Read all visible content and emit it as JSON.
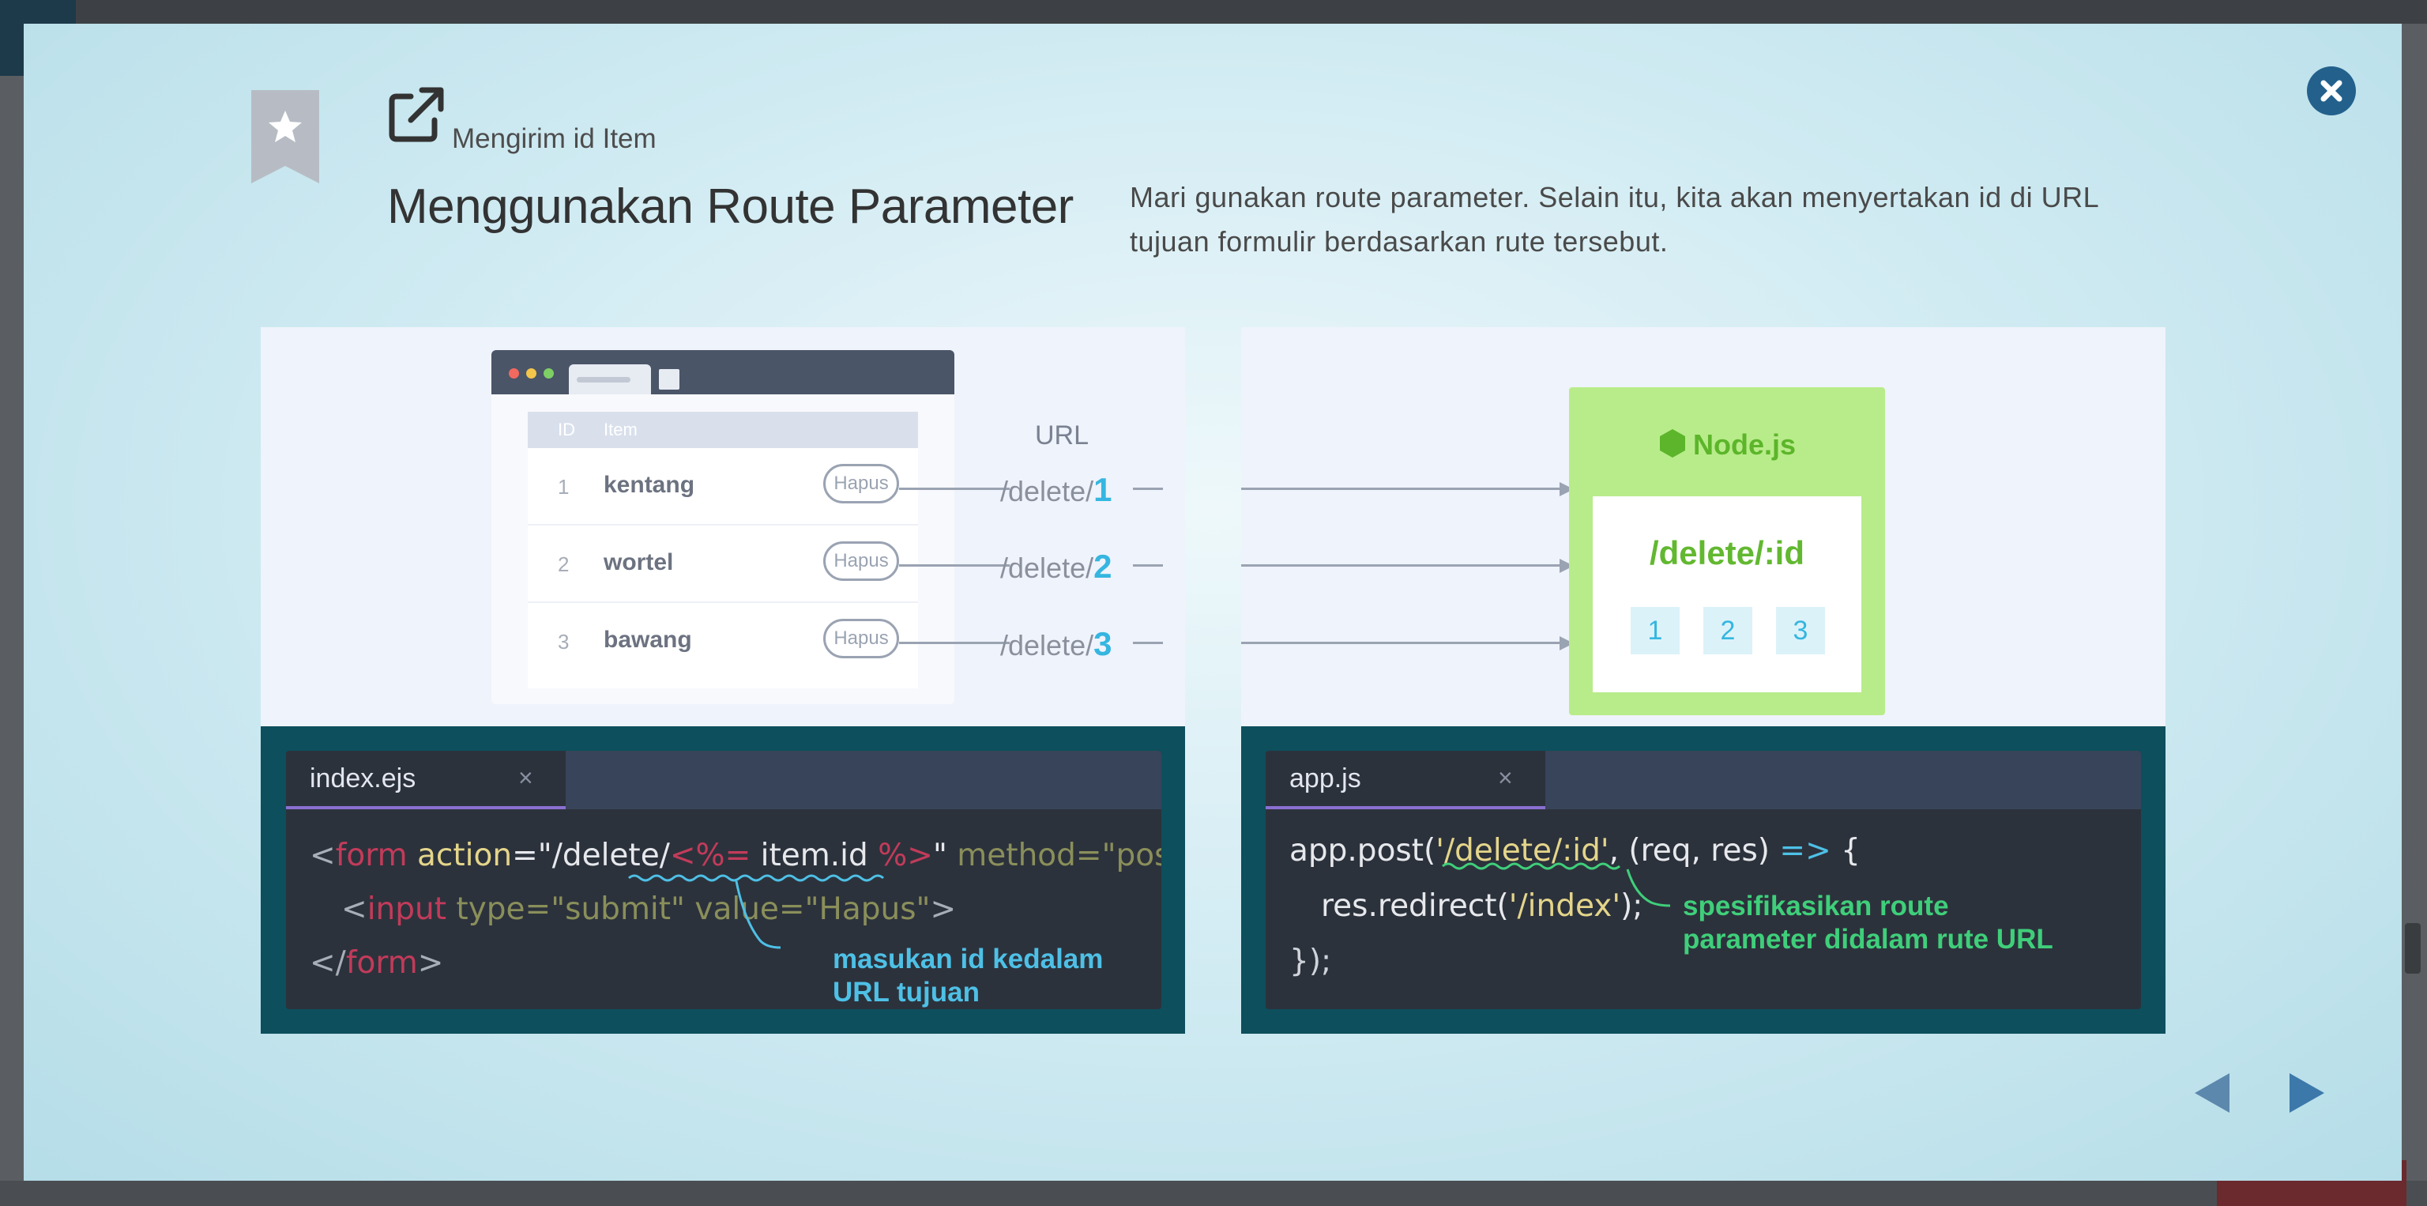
{
  "header": {
    "subtitle": "Mengirim id Item",
    "title": "Menggunakan Route Parameter",
    "description": "Mari gunakan route parameter. Selain itu, kita akan menyertakan id di URL tujuan formulir berdasarkan rute tersebut."
  },
  "diagram": {
    "table": {
      "headers": [
        "ID",
        "Item"
      ],
      "rows": [
        {
          "id": "1",
          "item": "kentang",
          "button": "Hapus"
        },
        {
          "id": "2",
          "item": "wortel",
          "button": "Hapus"
        },
        {
          "id": "3",
          "item": "bawang",
          "button": "Hapus"
        }
      ]
    },
    "url_label": "URL",
    "urls": [
      {
        "prefix": "/delete/",
        "id": "1"
      },
      {
        "prefix": "/delete/",
        "id": "2"
      },
      {
        "prefix": "/delete/",
        "id": "3"
      }
    ],
    "node": {
      "title": "Node.js",
      "route": "/delete/:id",
      "ids": [
        "1",
        "2",
        "3"
      ]
    }
  },
  "editor_left": {
    "tab": "index.ejs",
    "close": "×",
    "line1": {
      "lt": "<",
      "form": "form",
      "action": " action",
      "eq": "=",
      "path": "\"/delete/",
      "tag_open": "<%=",
      "expr": " item.id ",
      "tag_close": "%>",
      "quote": "\"",
      "method": " method=\"post\"",
      "gt": ">"
    },
    "line2": {
      "lt": "<",
      "input": "input",
      "type": " type=\"submit\"",
      "value": " value=\"Hapus\"",
      "gt": ">"
    },
    "line3": {
      "lt": "</",
      "form": "form",
      "gt": ">"
    },
    "annotation": [
      "masukan id kedalam",
      "URL tujuan"
    ]
  },
  "editor_right": {
    "tab": "app.js",
    "close": "×",
    "line1": {
      "a": "app.post(",
      "route": "'/delete/:id'",
      "b": ", (req, res) ",
      "arrow": "=>",
      "c": " {"
    },
    "line2": {
      "a": "res.redirect(",
      "route": "'/index'",
      "b": ");"
    },
    "line3": "});",
    "annotation": [
      "spesifikasikan route",
      "parameter didalam rute URL"
    ]
  },
  "colors": {
    "modal_close": "#23618c",
    "node_green": "#b8ec8a",
    "accent_blue": "#35b6e0",
    "annotation_blue": "#4ec0e6",
    "annotation_green": "#3fcf7a",
    "code_panel": "#0d4f5c"
  }
}
